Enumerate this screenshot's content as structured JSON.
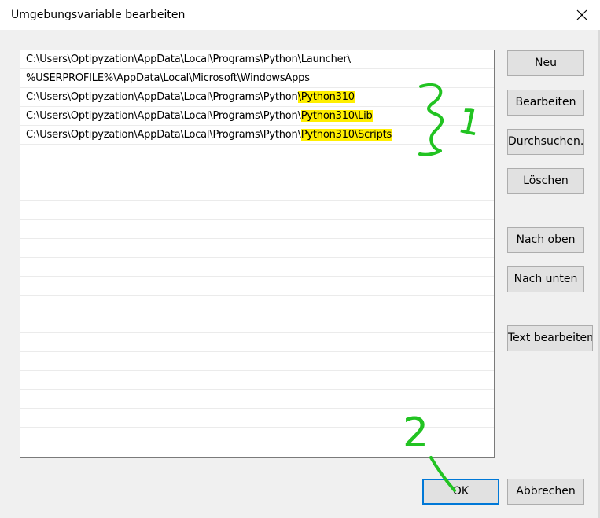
{
  "dialog": {
    "title": "Umgebungsvariable bearbeiten",
    "close_label": "✕"
  },
  "paths": [
    {
      "prefix": "C:\\Users\\Optipyzation\\AppData\\Local\\Programs\\Python\\Launcher\\",
      "highlight": ""
    },
    {
      "prefix": "%USERPROFILE%\\AppData\\Local\\Microsoft\\WindowsApps",
      "highlight": ""
    },
    {
      "prefix": "C:\\Users\\Optipyzation\\AppData\\Local\\Programs\\Python",
      "highlight": "\\Python310"
    },
    {
      "prefix": "C:\\Users\\Optipyzation\\AppData\\Local\\Programs\\Python\\",
      "highlight": "Python310\\Lib"
    },
    {
      "prefix": "C:\\Users\\Optipyzation\\AppData\\Local\\Programs\\Python\\",
      "highlight": "Python310\\Scripts"
    }
  ],
  "buttons": {
    "neu": "Neu",
    "bearbeiten": "Bearbeiten",
    "durchsuchen": "Durchsuchen...",
    "loeschen": "Löschen",
    "nach_oben": "Nach oben",
    "nach_unten": "Nach unten",
    "text_bearbeiten": "Text bearbeiten...",
    "ok": "OK",
    "abbrechen": "Abbrechen"
  },
  "annotations": {
    "marker_1": "1",
    "marker_2": "2",
    "marker_color": "#22c322"
  },
  "colors": {
    "highlight": "#ffef00",
    "accent": "#0078d7"
  }
}
